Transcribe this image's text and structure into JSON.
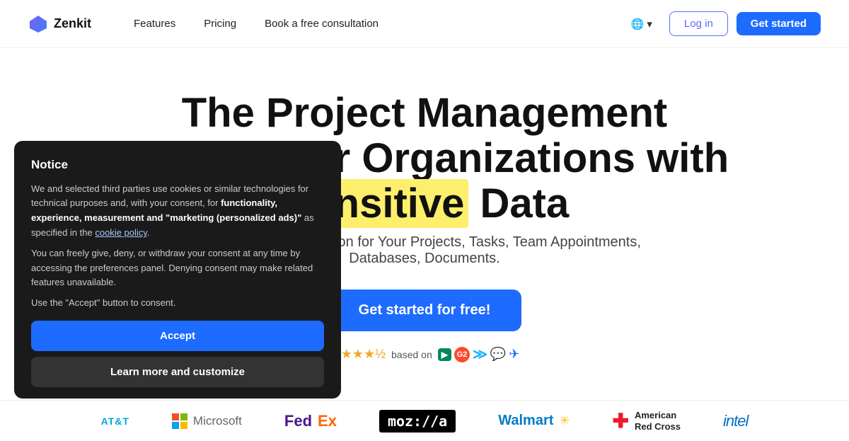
{
  "brand": {
    "name": "Zenkit"
  },
  "nav": {
    "features_label": "Features",
    "pricing_label": "Pricing",
    "consultation_label": "Book a free consultation",
    "lang_label": "🌐",
    "login_label": "Log in",
    "getstarted_label": "Get started"
  },
  "hero": {
    "title_part1": "The Project Management Solution for Organizations with ",
    "title_highlight": "Sensitive",
    "title_part2": " Data",
    "subtitle": "The All-in-One Solution for Your Projects, Tasks, Team Appointments, Databases, Documents.",
    "cta_label": "Get started for free!",
    "rating_text": "based on",
    "rating_value": "4.5"
  },
  "cookie": {
    "title": "Notice",
    "body1": "We and selected third parties use cookies or similar technologies for technical purposes and, with your consent, for ",
    "body_bold": "functionality, experience, measurement and \"marketing (personalized ads)\"",
    "body2": " as specified in the ",
    "cookie_policy_link": "cookie policy",
    "body3": ".",
    "body4": "You can freely give, deny, or withdraw your consent at any time by accessing the preferences panel. Denying consent may make related features unavailable.",
    "body5": "Use the \"Accept\" button to consent.",
    "accept_label": "Accept",
    "customize_label": "Learn more and customize"
  },
  "logos": [
    {
      "name": "AT&T",
      "type": "atnt"
    },
    {
      "name": "Microsoft",
      "type": "microsoft"
    },
    {
      "name": "FedEx",
      "type": "fedex"
    },
    {
      "name": "Mozilla",
      "type": "mozilla"
    },
    {
      "name": "Walmart",
      "type": "walmart"
    },
    {
      "name": "American Red Cross",
      "type": "arc"
    },
    {
      "name": "Intel",
      "type": "intel"
    }
  ]
}
